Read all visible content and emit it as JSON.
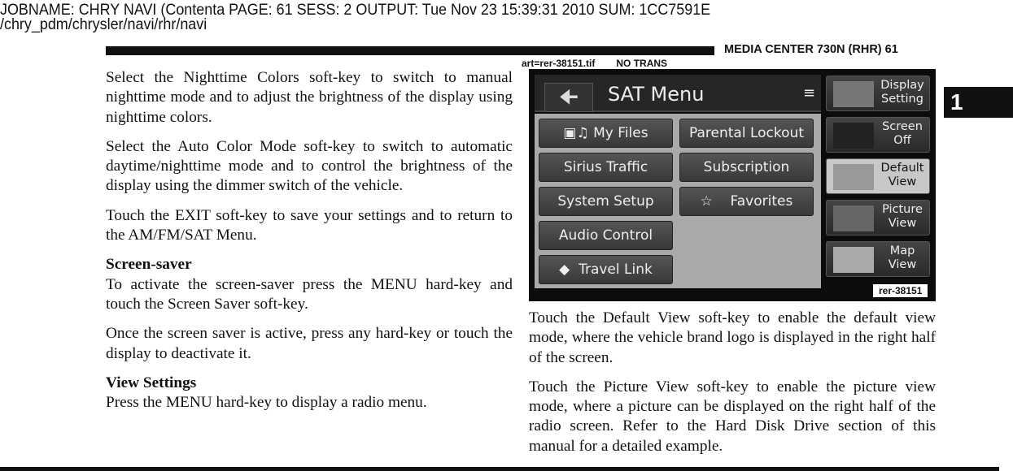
{
  "job_header": {
    "line1": "JOBNAME: CHRY NAVI (Contenta   PAGE: 61  SESS: 2  OUTPUT: Tue Nov 23 15:39:31 2010  SUM: 1CC7591E",
    "line2": "/chry_pdm/chrysler/navi/rhr/navi"
  },
  "running_head": "MEDIA CENTER 730N (RHR)   61",
  "chapter_tab": "1",
  "art_label": {
    "file": "art=rer-38151.tif",
    "trans": "NO TRANS"
  },
  "left_column": {
    "p1": "Select the Nighttime Colors soft-key to switch to manual nighttime mode and to adjust the brightness of the display using nighttime colors.",
    "p2": "Select the Auto Color Mode soft-key to switch to automatic daytime/nighttime mode and to control the brightness of the display using the dimmer switch of the vehicle.",
    "p3": "Touch the EXIT soft-key to save your settings and to return to the AM/FM/SAT Menu.",
    "h1": "Screen-saver",
    "p4": "To activate the screen-saver press the MENU hard-key and touch the Screen Saver soft-key.",
    "p5": "Once the screen saver is active, press any hard-key or touch the display to deactivate it.",
    "h2": "View Settings",
    "p6": "Press the MENU hard-key to display a radio menu."
  },
  "screen": {
    "title": "SAT Menu",
    "back_icon": "left-arrow",
    "buttons": [
      "My Files",
      "Parental Lockout",
      "Sirius Traffic",
      "Subscription",
      "System Setup",
      "Favorites",
      "Audio Control",
      "Travel Link"
    ],
    "side_buttons": [
      "Display Setting",
      "Screen Off",
      "Default View",
      "Picture View",
      "Map View"
    ],
    "active_side": "Default View",
    "art_id": "rer-38151"
  },
  "right_column": {
    "p1": "Touch the Default View soft-key to enable the default view mode, where the vehicle brand logo is displayed in the right half of the screen.",
    "p2": "Touch the Picture View soft-key to enable the picture view mode, where a picture can be displayed on the right half of the radio screen. Refer to the Hard Disk Drive section of this manual for a detailed example."
  }
}
